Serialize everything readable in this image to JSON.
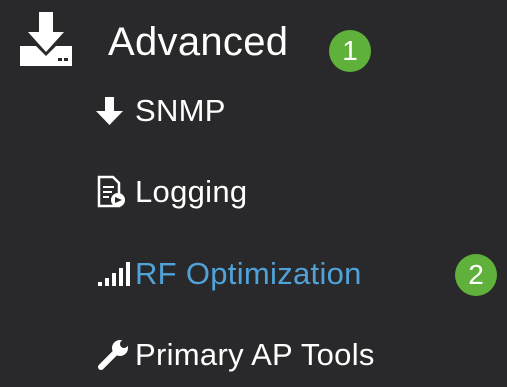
{
  "menu": {
    "section": {
      "title": "Advanced",
      "icon": "download-icon",
      "badge": "1"
    },
    "items": [
      {
        "label": "SNMP",
        "icon": "arrow-down-icon",
        "active": false
      },
      {
        "label": "Logging",
        "icon": "log-file-icon",
        "active": false
      },
      {
        "label": "RF Optimization",
        "icon": "signal-bars-icon",
        "active": true,
        "badge": "2"
      },
      {
        "label": "Primary AP Tools",
        "icon": "wrench-icon",
        "active": false
      }
    ]
  },
  "colors": {
    "background": "#29292b",
    "text": "#ffffff",
    "active_text": "#4fa3d9",
    "badge": "#5fb13b"
  }
}
